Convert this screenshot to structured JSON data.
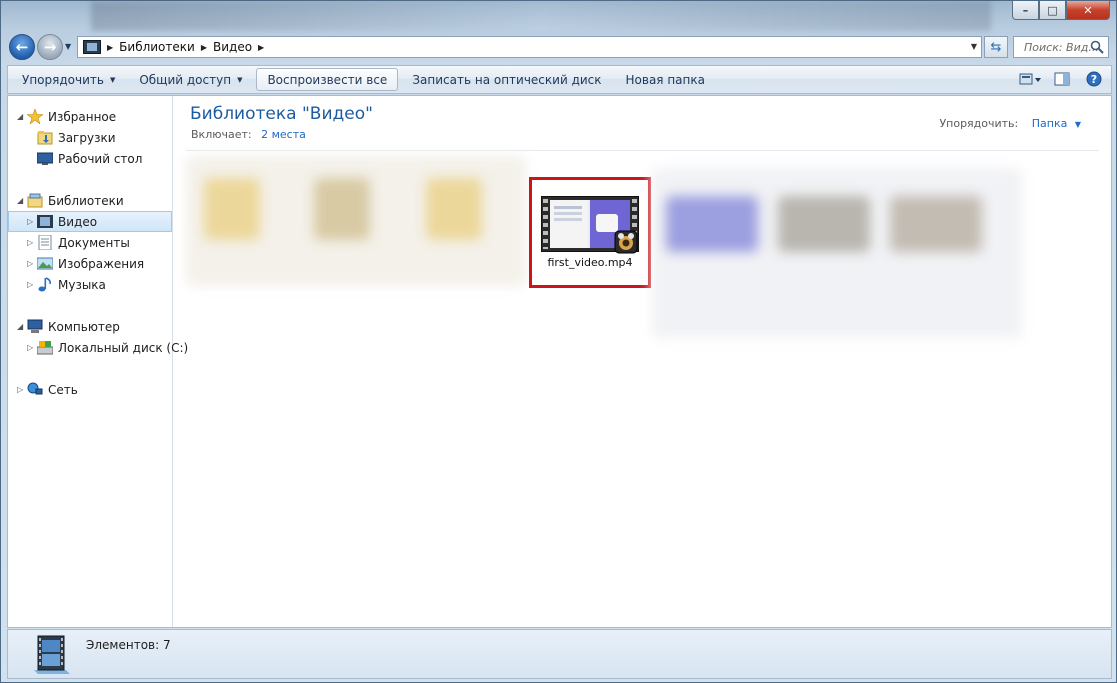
{
  "window": {
    "caption": {
      "minimize": "–",
      "maximize": "□",
      "close": "✕"
    }
  },
  "address": {
    "crumbs": [
      "Библиотеки",
      "Видео"
    ],
    "search_placeholder": "Поиск: Вид..."
  },
  "toolbar": {
    "organize": "Упорядочить",
    "share": "Общий доступ",
    "play_all": "Воспроизвести все",
    "burn": "Записать на оптический диск",
    "new_folder": "Новая папка"
  },
  "navpane": {
    "favorites": "Избранное",
    "downloads": "Загрузки",
    "desktop": "Рабочий стол",
    "libraries": "Библиотеки",
    "video": "Видео",
    "documents": "Документы",
    "images": "Изображения",
    "music": "Музыка",
    "computer": "Компьютер",
    "local_disk": "Локальный диск (C:)",
    "network": "Сеть"
  },
  "main": {
    "title": "Библиотека \"Видео\"",
    "includes_label": "Включает:",
    "includes_link": "2 места",
    "arrange_label": "Упорядочить:",
    "arrange_value": "Папка",
    "selected_file": "first_video.mp4"
  },
  "status": {
    "items": "Элементов: 7"
  },
  "colors": {
    "selection_border": "#c8161b",
    "title": "#1e5a9f",
    "link": "#1e6ac6"
  }
}
